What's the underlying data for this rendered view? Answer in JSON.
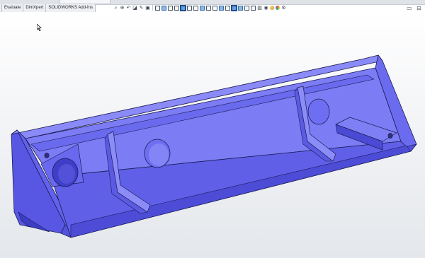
{
  "command_tabs": [
    "",
    "Evaluate",
    "DimXpert",
    "SOLIDWORKS Add-Ins"
  ],
  "heads_up_toolbar": {
    "tools": [
      {
        "icon": "zoom-to-fit-icon",
        "glyph": "⌕"
      },
      {
        "icon": "zoom-area-icon",
        "glyph": "⊕"
      },
      {
        "icon": "previous-view-icon",
        "glyph": "↶"
      },
      {
        "icon": "section-view-icon",
        "glyph": "◪"
      },
      {
        "icon": "dynamic-annotation-icon",
        "glyph": "✎"
      },
      {
        "icon": "view-orientation-icon",
        "glyph": "▣"
      },
      {
        "icon": "display-style-icon",
        "glyph": "▨"
      },
      {
        "icon": "hide-show-items-icon",
        "glyph": "◉"
      },
      {
        "icon": "edit-appearance-icon",
        "glyph": "●"
      },
      {
        "icon": "apply-scene-icon",
        "glyph": "◐"
      },
      {
        "icon": "view-settings-icon",
        "glyph": "⚙"
      }
    ],
    "view_cubes": 16
  },
  "right_tools": [
    "▭",
    "⊟"
  ],
  "model": {
    "type": "bracket-housing",
    "color": "#6f6ff2",
    "shade_dark": "#4a4ad8",
    "shade_light": "#8c8cf8",
    "edge_color": "#1b1b55"
  }
}
